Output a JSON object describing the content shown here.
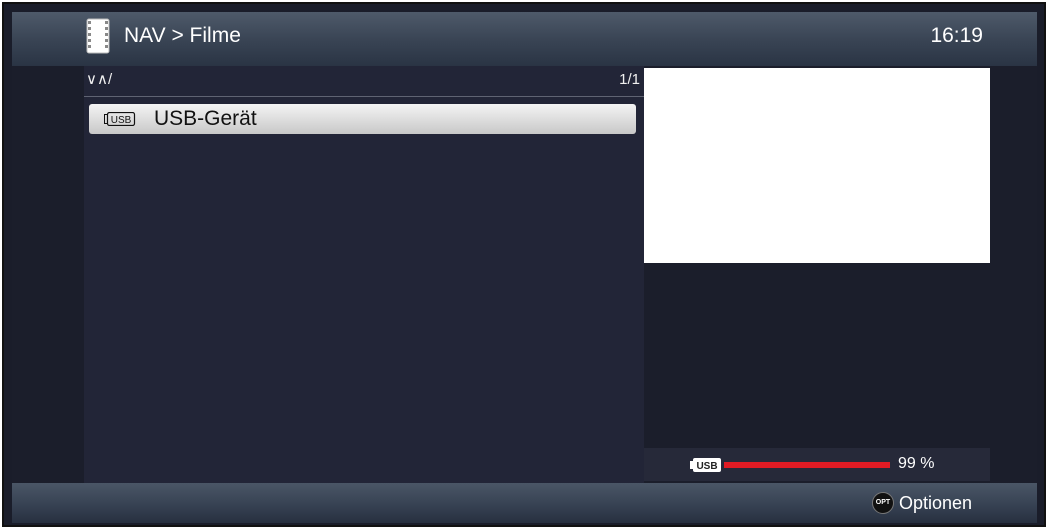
{
  "header": {
    "title": "NAV > Filme",
    "time": "16:19",
    "icon": "film-strip-icon"
  },
  "browser": {
    "path": "∨∧/",
    "page": "1/1",
    "items": [
      {
        "label": "USB-Gerät",
        "icon": "usb-drive-icon",
        "selected": true
      }
    ]
  },
  "storage": {
    "icon": "usb-drive-icon",
    "usage_percent": 99,
    "usage_label": "99 %",
    "bar_color": "#e01b24"
  },
  "footer": {
    "options_button_text": "OPT",
    "options_label": "Optionen"
  }
}
